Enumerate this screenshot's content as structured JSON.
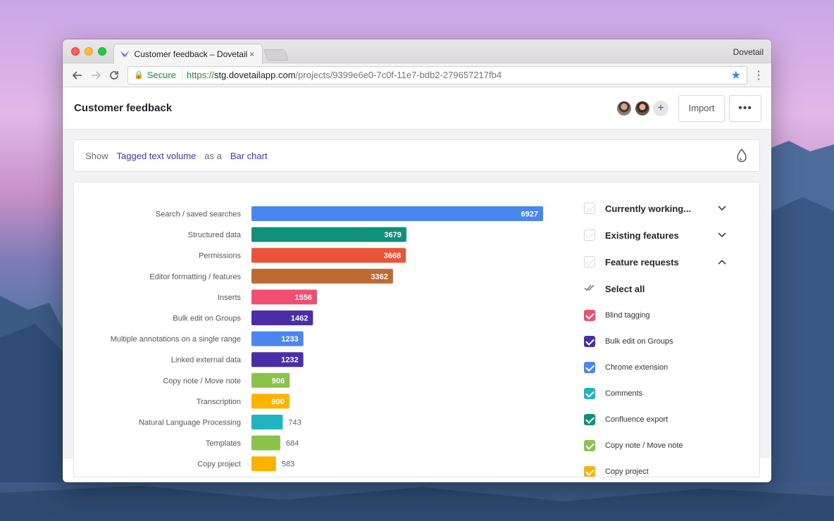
{
  "browser": {
    "tab_title": "Customer feedback – Dovetail",
    "tab_close": "×",
    "profile_name": "Dovetail",
    "secure_label": "Secure",
    "url_protocol": "https://",
    "url_host": "stg.dovetailapp.com",
    "url_path": "/projects/9399e6e0-7c0f-11e7-bdb2-279657217fb4"
  },
  "header": {
    "title": "Customer feedback",
    "add_label": "+",
    "import_label": "Import",
    "more_label": "•••"
  },
  "showbar": {
    "show_label": "Show",
    "metric": "Tagged text volume",
    "as_label": "as a",
    "chart_type": "Bar chart"
  },
  "legend": {
    "groups": [
      {
        "label": "Currently working...",
        "expanded": false
      },
      {
        "label": "Existing features",
        "expanded": false
      },
      {
        "label": "Feature requests",
        "expanded": true
      }
    ],
    "select_all": "Select all",
    "items": [
      {
        "label": "Blind tagging",
        "color": "#f24e72"
      },
      {
        "label": "Bulk edit on Groups",
        "color": "#4a2ea8"
      },
      {
        "label": "Chrome extension",
        "color": "#4a86f0"
      },
      {
        "label": "Comments",
        "color": "#1fb4bf"
      },
      {
        "label": "Confluence export",
        "color": "#0f9078"
      },
      {
        "label": "Copy note / Move note",
        "color": "#8bc34a"
      },
      {
        "label": "Copy project",
        "color": "#ffb300"
      }
    ]
  },
  "chart_data": {
    "type": "bar",
    "orientation": "horizontal",
    "categories": [
      "Search / saved searches",
      "Structured data",
      "Permissions",
      "Editor formatting / features",
      "Inserts",
      "Bulk edit on Groups",
      "Multiple annotations on a single range",
      "Linked external data",
      "Copy note / Move note",
      "Transcription",
      "Natural Language Processing",
      "Templates",
      "Copy project"
    ],
    "values": [
      6927,
      3679,
      3668,
      3362,
      1556,
      1462,
      1233,
      1232,
      906,
      900,
      743,
      684,
      583
    ],
    "colors": [
      "#4a86f0",
      "#0f9078",
      "#ea5538",
      "#c06a33",
      "#f24e72",
      "#4a2ea8",
      "#4a86f0",
      "#4a2ea8",
      "#8bc34a",
      "#ffb300",
      "#1fb4bf",
      "#8bc34a",
      "#ffb300"
    ],
    "xlim": [
      0,
      6927
    ],
    "title": "",
    "xlabel": "",
    "ylabel": ""
  }
}
